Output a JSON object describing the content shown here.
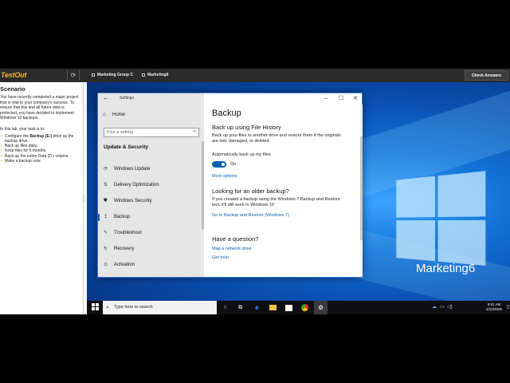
{
  "topbar": {
    "logo": "TestOut",
    "refresh_glyph": "⟳",
    "group": "Marketing Group C",
    "machine": "Marketing6",
    "check_answers": "Check Answers"
  },
  "scenario": {
    "title": "Scenario",
    "paragraph": "You have recently completed a major project that is vital to your company's success. To ensure that this and all future data is protected, you have decided to implement Windows 10 backups.",
    "intro": "In this lab, your task is to:",
    "tasks": [
      {
        "pre": "Configure the ",
        "bold": "Backup (E:)",
        "post": " drive as the backup drive."
      },
      {
        "pre": "Back up files daily.",
        "bold": "",
        "post": ""
      },
      {
        "pre": "Keep files for 6 months.",
        "bold": "",
        "post": ""
      },
      {
        "pre": "Back up the entire Data (D:) volume.",
        "bold": "",
        "post": ""
      },
      {
        "pre": "Make a backup now.",
        "bold": "",
        "post": ""
      }
    ]
  },
  "settings": {
    "window_title": "Settings",
    "home": "Home",
    "search_placeholder": "Find a setting",
    "section": "Update & Security",
    "nav": [
      {
        "label": "Windows Update",
        "icon": "sync-icon",
        "glyph": "⟳"
      },
      {
        "label": "Delivery Optimization",
        "icon": "delivery-icon",
        "glyph": "⇅"
      },
      {
        "label": "Windows Security",
        "icon": "shield-icon",
        "glyph": "⛊"
      },
      {
        "label": "Backup",
        "icon": "backup-icon",
        "glyph": "↥"
      },
      {
        "label": "Troubleshoot",
        "icon": "wrench-icon",
        "glyph": "✎"
      },
      {
        "label": "Recovery",
        "icon": "recovery-icon",
        "glyph": "↻"
      },
      {
        "label": "Activation",
        "icon": "activation-icon",
        "glyph": "⊙"
      }
    ],
    "selected": "Backup",
    "content": {
      "heading": "Backup",
      "file_history_heading": "Back up using File History",
      "file_history_desc": "Back up your files to another drive and restore them if the originals are lost, damaged, or deleted.",
      "auto_backup_label": "Automatically back up my files",
      "toggle_state": "On",
      "more_options": "More options",
      "older_heading": "Looking for an older backup?",
      "older_desc": "If you created a backup using the Windows 7 Backup and Restore tool, it'll still work in Windows 10",
      "older_link": "Go to Backup and Restore (Windows 7)",
      "question_heading": "Have a question?",
      "map_drive": "Map a network drive",
      "get_help": "Get help"
    }
  },
  "desktop": {
    "machine_name": "Marketing6"
  },
  "taskbar": {
    "search_placeholder": "Type here to search",
    "apps": [
      "task-view-icon",
      "cortana-icon",
      "edge-icon",
      "file-explorer-icon",
      "store-icon",
      "chrome-icon",
      "settings-icon"
    ],
    "time": "9:51 AM",
    "date": "2/10/2025"
  },
  "colors": {
    "accent": "#0063b1",
    "logo": "#f2b233",
    "desktop_blue": "#1272d6"
  }
}
